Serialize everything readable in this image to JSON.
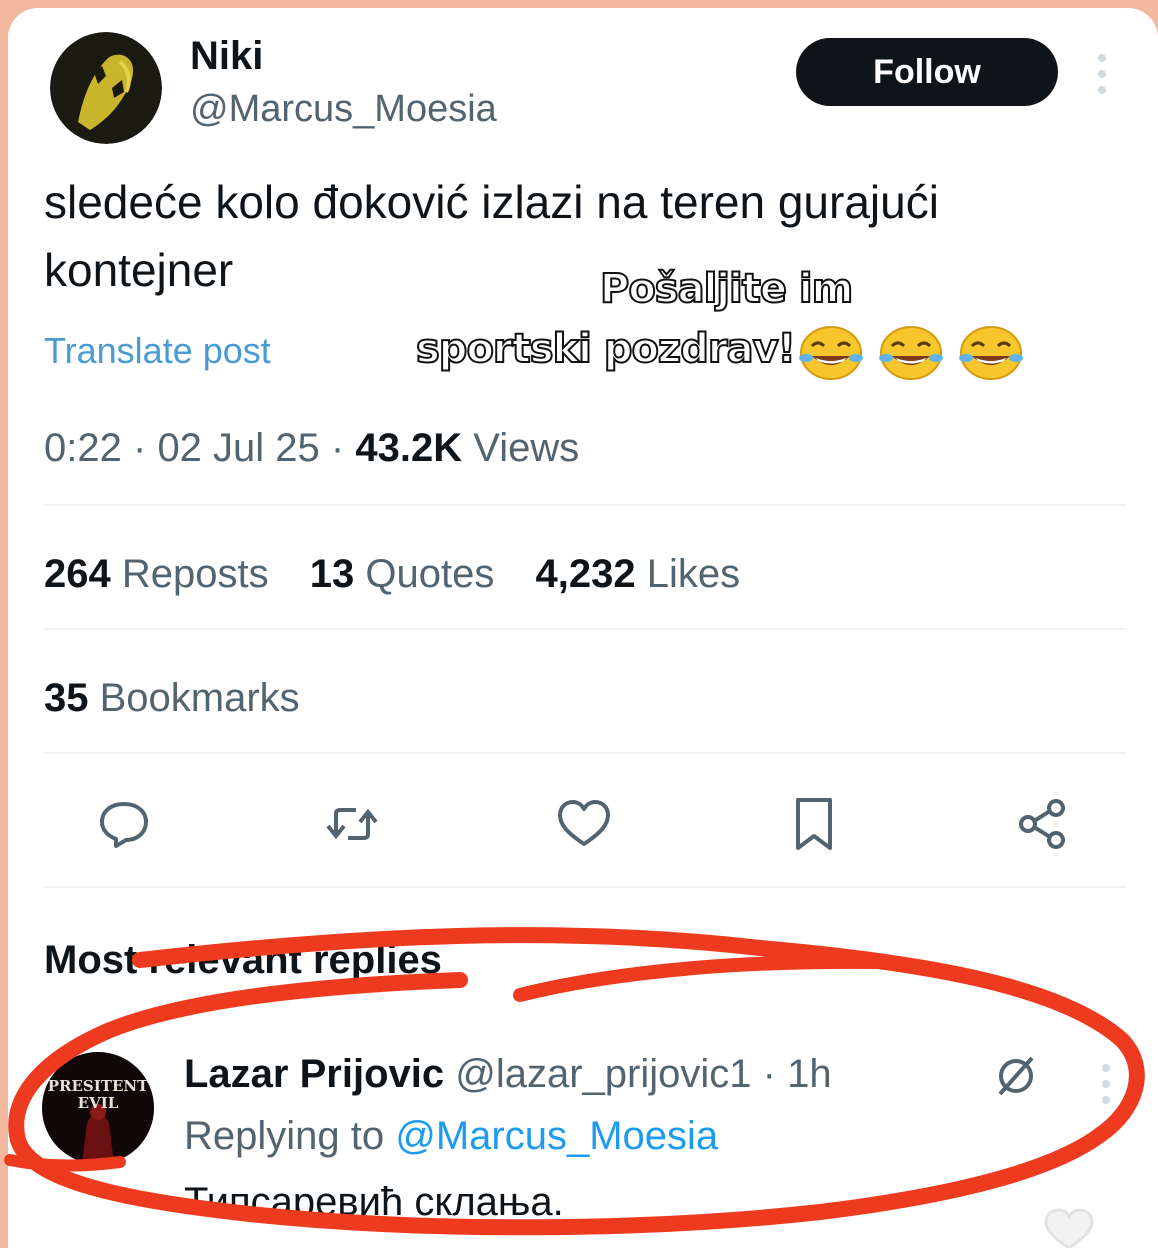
{
  "tweet": {
    "author_name": "Niki",
    "author_handle": "@Marcus_Moesia",
    "follow_label": "Follow",
    "text": "sledeće kolo đoković izlazi na teren gurajući kontejner",
    "translate_label": "Translate post",
    "time": "0:22",
    "date": "02 Jul 25",
    "separator": "·",
    "views_count": "43.2K",
    "views_label": "Views"
  },
  "overlay": {
    "line1": "Pošaljite im",
    "line2": "sportski pozdrav!",
    "emoji_name": "tears-of-joy-emoji"
  },
  "stats": {
    "reposts_count": "264",
    "reposts_label": "Reposts",
    "quotes_count": "13",
    "quotes_label": "Quotes",
    "likes_count": "4,232",
    "likes_label": "Likes",
    "bookmarks_count": "35",
    "bookmarks_label": "Bookmarks"
  },
  "actions": [
    "reply-icon",
    "repost-icon",
    "like-icon",
    "bookmark-icon",
    "share-icon"
  ],
  "replies": {
    "heading": "Most relevant replies",
    "items": [
      {
        "name": "Lazar Prijovic",
        "handle": "@lazar_prijovic1",
        "time": "1h",
        "replying_prefix": "Replying to",
        "replying_to": "@Marcus_Moesia",
        "text": "Типсаревић склања.",
        "avatar_text": "PRESITENT EVIL"
      }
    ]
  },
  "colors": {
    "frame": "#f2b8a0",
    "annotation": "#ee3b1f",
    "link": "#1d9bf0",
    "muted": "#536471",
    "text": "#0f1419"
  }
}
